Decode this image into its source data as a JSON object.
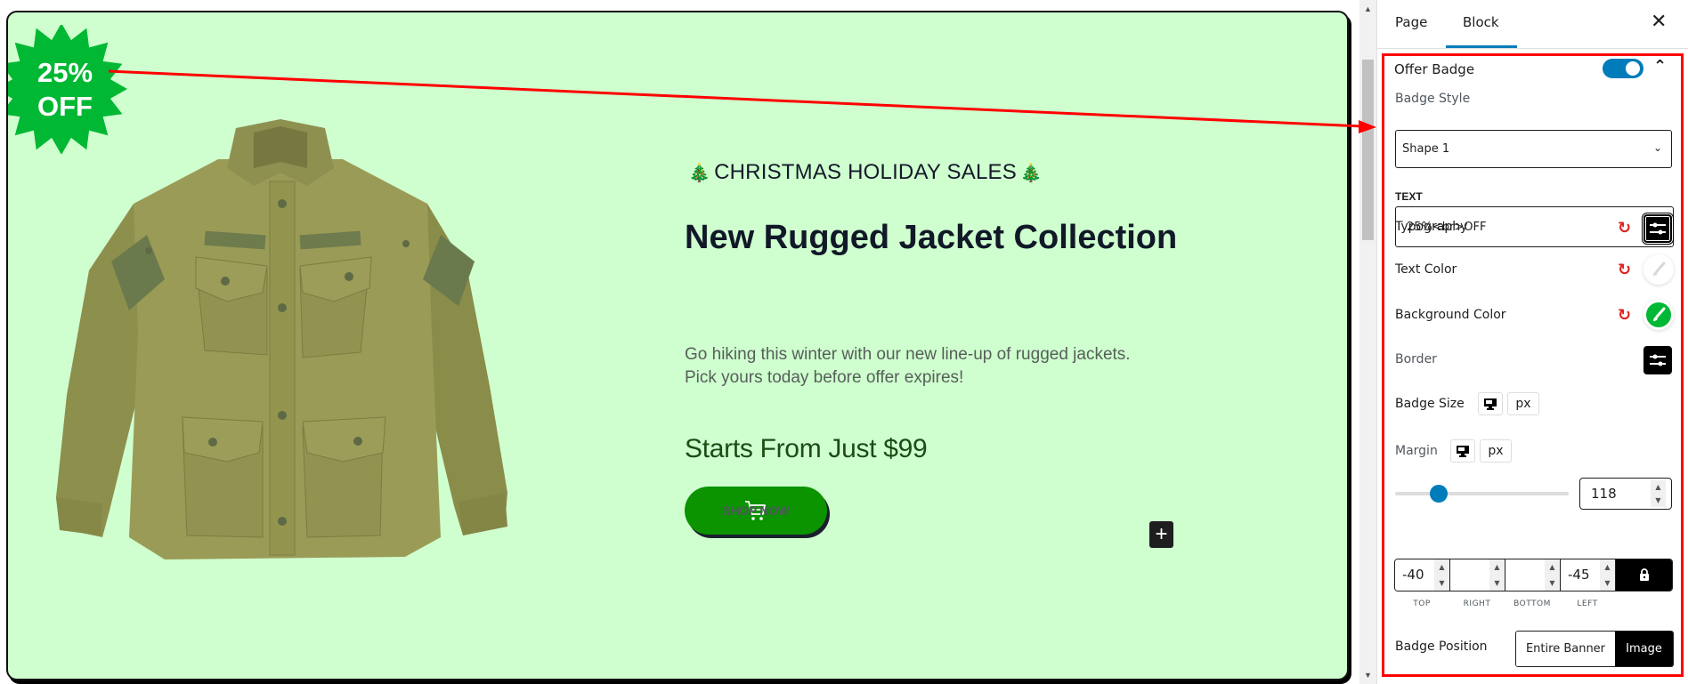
{
  "banner": {
    "background_color": "#cfffcf",
    "badge": {
      "line1": "25%",
      "line2": "OFF",
      "color": "#00b833"
    },
    "product_image_alt": "olive green rugged jacket",
    "eyebrow": "CHRISTMAS HOLIDAY SALES",
    "eyebrow_icon": "christmas-tree-icon",
    "eyebrow_icon_glyph": "🎄",
    "title": "New Rugged Jacket Collection",
    "description_line1": "Go hiking this winter with our new line-up of rugged jackets.",
    "description_line2": "Pick yours today before offer expires!",
    "price_text": "Starts From Just $99",
    "cta": {
      "label": "SHOP NOW",
      "icon": "cart-icon",
      "color": "#0b9300"
    },
    "add_block_glyph": "+"
  },
  "sidebar": {
    "tabs": [
      {
        "label": "Page",
        "active": false
      },
      {
        "label": "Block",
        "active": true
      }
    ],
    "close_glyph": "✕",
    "panel": {
      "title": "Offer Badge",
      "enabled": true,
      "badge_style": {
        "label": "Badge Style",
        "selected": "Shape 1"
      },
      "text": {
        "label": "TEXT",
        "value": "25%<br>OFF"
      },
      "typography_label": "Typography",
      "text_color": {
        "label": "Text Color",
        "value": "#ffffff"
      },
      "background_color": {
        "label": "Background Color",
        "value": "#00b833"
      },
      "border_label": "Border",
      "badge_size": {
        "label": "Badge Size",
        "unit": "px",
        "value": "118",
        "slider_fraction": 0.25
      },
      "margin": {
        "label": "Margin",
        "unit": "px",
        "fields": [
          {
            "side": "TOP",
            "value": "-40"
          },
          {
            "side": "RIGHT",
            "value": ""
          },
          {
            "side": "BOTTOM",
            "value": ""
          },
          {
            "side": "LEFT",
            "value": "-45"
          }
        ],
        "linked": true
      },
      "badge_position": {
        "label": "Badge Position",
        "options": [
          "Entire Banner",
          "Image"
        ],
        "selected": "Image"
      }
    }
  },
  "annotation": {
    "color": "#ff0000"
  }
}
